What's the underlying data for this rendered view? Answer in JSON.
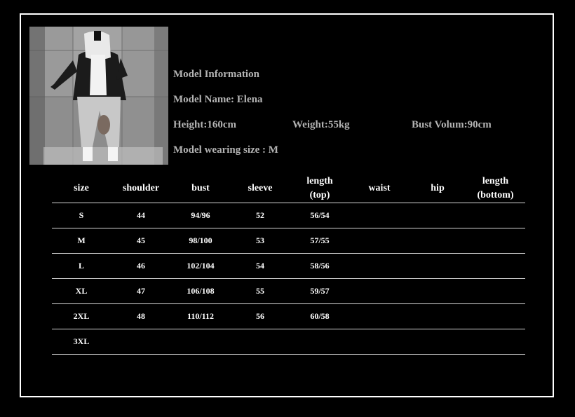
{
  "model": {
    "heading": "Model Information",
    "name": "Model Name: Elena",
    "height": "Height:160cm",
    "weight": "Weight:55kg",
    "bust": "Bust Volum:90cm",
    "wearing_size": "Model wearing size : M"
  },
  "size_table": {
    "headers": [
      {
        "line1": "size",
        "line2": ""
      },
      {
        "line1": "shoulder",
        "line2": ""
      },
      {
        "line1": "bust",
        "line2": ""
      },
      {
        "line1": "sleeve",
        "line2": ""
      },
      {
        "line1": "length",
        "line2": "(top)"
      },
      {
        "line1": "waist",
        "line2": ""
      },
      {
        "line1": "hip",
        "line2": ""
      },
      {
        "line1": "length",
        "line2": "(bottom)"
      }
    ],
    "rows": [
      [
        "S",
        "44",
        "94/96",
        "52",
        "56/54",
        "",
        "",
        ""
      ],
      [
        "M",
        "45",
        "98/100",
        "53",
        "57/55",
        "",
        "",
        ""
      ],
      [
        "L",
        "46",
        "102/104",
        "54",
        "58/56",
        "",
        "",
        ""
      ],
      [
        "XL",
        "47",
        "106/108",
        "55",
        "59/57",
        "",
        "",
        ""
      ],
      [
        "2XL",
        "48",
        "110/112",
        "56",
        "60/58",
        "",
        "",
        ""
      ],
      [
        "3XL",
        "",
        "",
        "",
        "",
        "",
        "",
        ""
      ]
    ]
  },
  "colors": {
    "background": "#000000",
    "frame": "#ffffff",
    "info_text": "#b3b3b3",
    "table_text": "#ffffff"
  }
}
